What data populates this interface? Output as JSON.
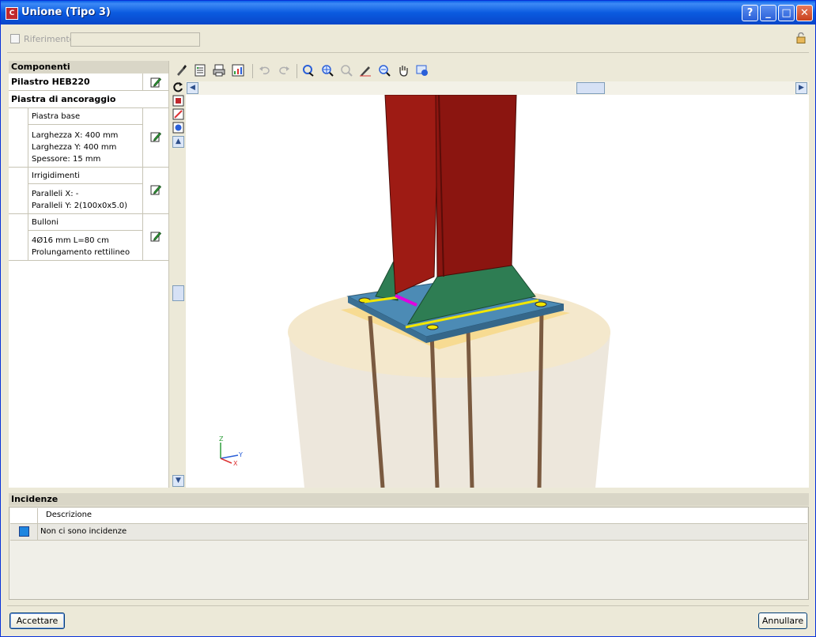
{
  "window": {
    "title": "Unione (Tipo 3)"
  },
  "title_buttons": {
    "help": "?",
    "minimize": "_",
    "maximize": "□",
    "close": "✕"
  },
  "reference": {
    "label": "Riferimento",
    "value": ""
  },
  "components": {
    "header": "Componenti",
    "column": "Pilastro HEB220",
    "anchor_plate": "Piastra di ancoraggio",
    "items": [
      {
        "title": "Piastra base",
        "lines": [
          "Larghezza X: 400 mm",
          "Larghezza Y: 400 mm",
          "Spessore: 15 mm"
        ]
      },
      {
        "title": "Irrigidimenti",
        "lines": [
          "Paralleli X: -",
          "Paralleli Y: 2(100x0x5.0)"
        ]
      },
      {
        "title": "Bulloni",
        "lines": [
          "4Ø16 mm L=80 cm",
          "Prolungamento rettilineo"
        ]
      }
    ]
  },
  "incidents": {
    "header": "Incidenze",
    "column": "Descrizione",
    "rows": [
      "Non ci sono incidenze"
    ]
  },
  "axes": {
    "z": "Z",
    "y": "Y",
    "x": "X"
  },
  "buttons": {
    "accept": "Accettare",
    "cancel": "Annullare"
  },
  "colors": {
    "title_bar": "#0a5ee8",
    "steel": "#9e1b14",
    "plate": "#4c8bb5",
    "stiffener": "#2e7d53",
    "weld": "#f2e600",
    "concrete": "#efe6d4"
  }
}
